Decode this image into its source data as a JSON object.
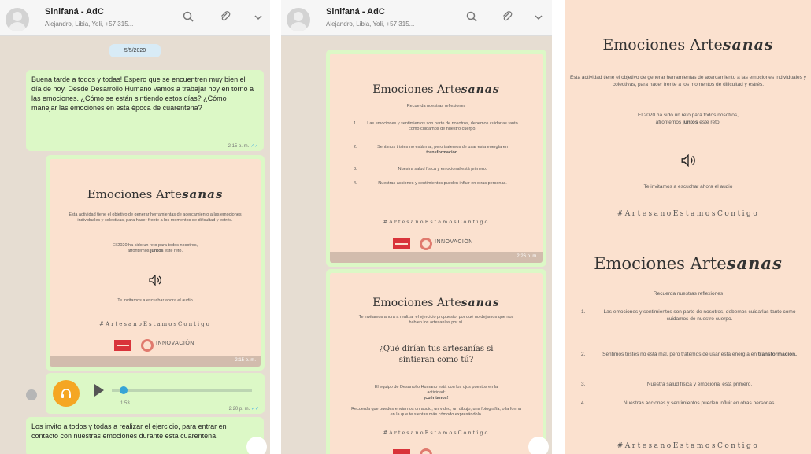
{
  "chat": {
    "name": "Sinifaná - AdC",
    "members": "Alejandro, Libia, Yoli, +57 315...",
    "date": "5/5/2020"
  },
  "icons": {
    "search": "search-icon",
    "attach": "paperclip-icon",
    "menu": "chevron-down-icon",
    "headphones": "headphones-icon",
    "speaker": "speaker-icon"
  },
  "colors": {
    "outgoing_bubble": "#dcf8c6",
    "chat_background": "#e6ddd2",
    "card_background": "#fbe1cf",
    "audio_button": "#f5a623",
    "logo_red": "#d9333a"
  },
  "messages": {
    "greeting": {
      "text": "Buena tarde a todos y todas! Espero que se encuentren muy bien el día de hoy. Desde Desarrollo Humano vamos a trabajar hoy en torno a las emociones. ¿Cómo se están sintiendo estos días? ¿Cómo manejar las emociones en esta época de cuarentena?",
      "time": "2:15 p. m."
    },
    "image1_time": "2:15 p. m.",
    "audio": {
      "duration": "1:53",
      "time": "2:20 p. m."
    },
    "invite": {
      "text": "Los invito a todos y todas a realizar el ejercicio, para entrar en contacto con nuestras emociones durante esta cuarentena."
    },
    "image2_time": "2:26 p. m."
  },
  "card": {
    "title_plain": "Emociones Arte",
    "title_bold": "sanas",
    "intro": "Esta actividad tiene el objetivo de generar herramientas de acercamiento a las emociones individuales y colectivas, para hacer frente a los momentos de dificultad y estrés.",
    "year_prefix": "El 2020 ha sido un reto para todos nosotros, afrontemos",
    "year_bold": "juntos",
    "year_suffix": "este reto.",
    "audio_invite": "Te invitamos a escuchar ahora el audio",
    "hashtag": "#ArtesanoEstamosContigo",
    "reflections_header": "Recuerda nuestras reflexiones",
    "reflections": [
      {
        "num": "1.",
        "text": "Las emociones y sentimientos son parte de nosotros, debemos cuidarlas tanto como cuidamos de nuestro cuerpo."
      },
      {
        "num": "2.",
        "text": "Sentimos tristes no está mal, pero tratemos de usar esta energía en",
        "bold": "transformación."
      },
      {
        "num": "3.",
        "text": "Nuestra salud física y emocional está primero."
      },
      {
        "num": "4.",
        "text": "Nuestras acciones y sentimientos pueden influir en otras personas."
      }
    ],
    "logo_label": "INNOVACIÓN",
    "invite_text": "Te invitamos ahora a realizar el ejercicio propuesto, por qué no dejamos que nos hablen los artesanías por sí.",
    "question": "¿Qué dirían tus artesanías si sintieran como tú?",
    "team_text": "El equipo de Desarrollo Humano está con los ojos puestos en la actividad:",
    "team_bold": "¡cuéntanos!",
    "share_text": "Recuerda que puedes enviarnos un audio, un video, un dibujo, una fotografía, o la forma en la que te sientas más cómodo expresándolo."
  }
}
